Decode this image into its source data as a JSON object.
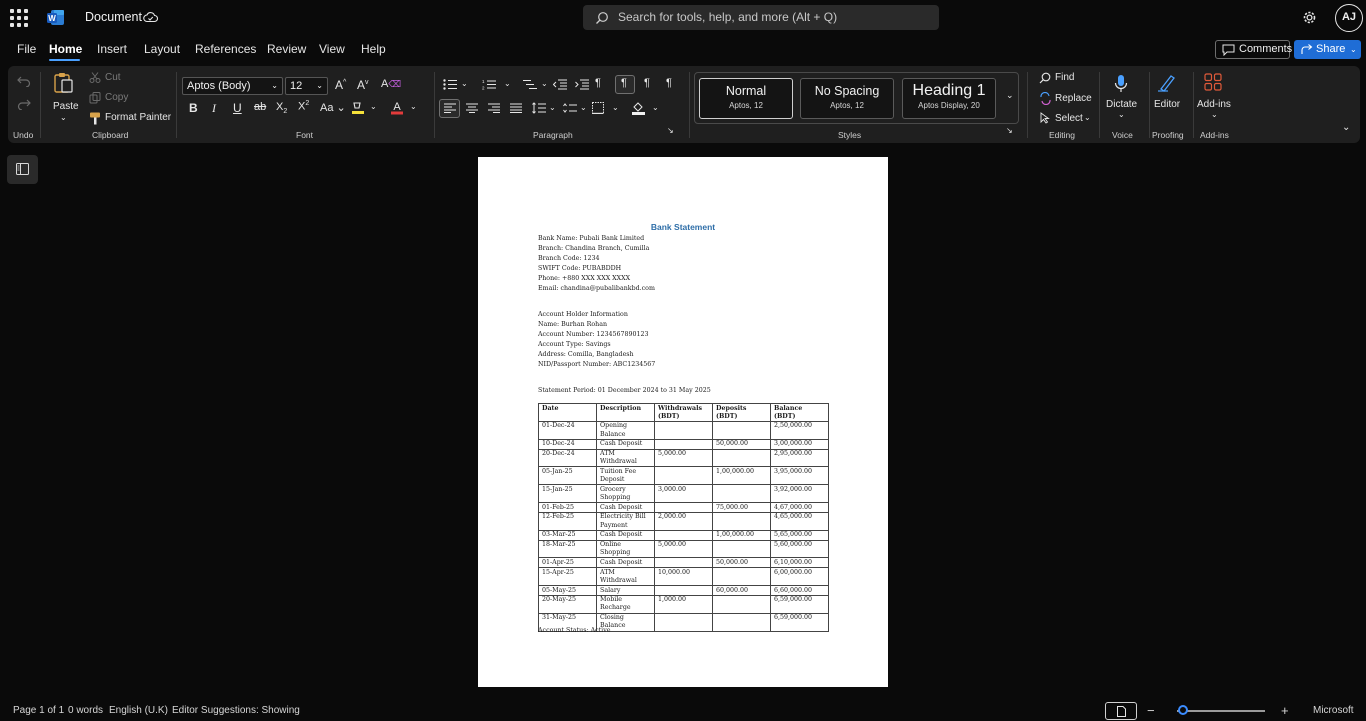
{
  "titlebar": {
    "app_name": "Document",
    "search_placeholder": "Search for tools, help, and more (Alt + Q)",
    "user_initials": "AJ"
  },
  "menu": {
    "tabs": [
      "File",
      "Home",
      "Insert",
      "Layout",
      "References",
      "Review",
      "View",
      "Help"
    ],
    "active_tab": "Home",
    "comments_label": "Comments",
    "share_label": "Share"
  },
  "ribbon": {
    "undo_group": "Undo",
    "clipboard": {
      "paste": "Paste",
      "cut": "Cut",
      "copy": "Copy",
      "format_painter": "Format Painter",
      "group": "Clipboard"
    },
    "font": {
      "family": "Aptos (Body)",
      "size": "12",
      "group": "Font"
    },
    "paragraph": {
      "group": "Paragraph"
    },
    "styles": {
      "group": "Styles",
      "items": [
        {
          "name": "Normal",
          "detail": "Aptos, 12"
        },
        {
          "name": "No Spacing",
          "detail": "Aptos, 12"
        },
        {
          "name": "Heading 1",
          "detail": "Aptos Display, 20"
        }
      ]
    },
    "editing": {
      "find": "Find",
      "replace": "Replace",
      "select": "Select",
      "group": "Editing"
    },
    "voice": {
      "dictate": "Dictate",
      "group": "Voice"
    },
    "proofing": {
      "editor": "Editor",
      "group": "Proofing"
    },
    "addins": {
      "addins": "Add-ins",
      "group": "Add-ins"
    }
  },
  "document": {
    "heading": "Bank Statement",
    "bank_lines": [
      "Bank Name: Pubali Bank Limited",
      "Branch: Chandina Branch, Cumilla",
      "Branch Code: 1234",
      "SWIFT Code: PUBABDDH",
      "Phone: +880 XXX XXX XXXX",
      "Email: chandina@pubalibankbd.com"
    ],
    "holder_lines": [
      "Account Holder Information",
      "Name: Burhan Rohan",
      "Account Number: 1234567890123",
      "Account Type: Savings",
      "Address: Comilla, Bangladesh",
      "NID/Passport Number: ABC1234567"
    ],
    "period": "Statement Period: 01 December 2024 to 31 May 2025",
    "table": {
      "headers": [
        "Date",
        "Description",
        "Withdrawals (BDT)",
        "Deposits (BDT)",
        "Balance (BDT)"
      ],
      "rows": [
        [
          "01-Dec-24",
          "Opening Balance",
          "",
          "",
          "2,50,000.00"
        ],
        [
          "10-Dec-24",
          "Cash Deposit",
          "",
          "50,000.00",
          "3,00,000.00"
        ],
        [
          "20-Dec-24",
          "ATM Withdrawal",
          "5,000.00",
          "",
          "2,95,000.00"
        ],
        [
          "05-Jan-25",
          "Tuition Fee Deposit",
          "",
          "1,00,000.00",
          "3,95,000.00"
        ],
        [
          "15-Jan-25",
          "Grocery Shopping",
          "3,000.00",
          "",
          "3,92,000.00"
        ],
        [
          "01-Feb-25",
          "Cash Deposit",
          "",
          "75,000.00",
          "4,67,000.00"
        ],
        [
          "12-Feb-25",
          "Electricity Bill Payment",
          "2,000.00",
          "",
          "4,65,000.00"
        ],
        [
          "03-Mar-25",
          "Cash Deposit",
          "",
          "1,00,000.00",
          "5,65,000.00"
        ],
        [
          "18-Mar-25",
          "Online Shopping",
          "5,000.00",
          "",
          "5,60,000.00"
        ],
        [
          "01-Apr-25",
          "Cash Deposit",
          "",
          "50,000.00",
          "6,10,000.00"
        ],
        [
          "15-Apr-25",
          "ATM Withdrawal",
          "10,000.00",
          "",
          "6,00,000.00"
        ],
        [
          "05-May-25",
          "Salary",
          "",
          "60,000.00",
          "6,60,000.00"
        ],
        [
          "20-May-25",
          "Mobile Recharge",
          "1,000.00",
          "",
          "6,59,000.00"
        ],
        [
          "31-May-25",
          "Closing Balance",
          "",
          "",
          "6,59,000.00"
        ]
      ]
    },
    "status": "Account Status: Active"
  },
  "statusbar": {
    "page": "Page 1 of 1",
    "words": "0 words",
    "language": "English (U.K)",
    "editor_suggestions": "Editor Suggestions: Showing",
    "zoom_minus": "−",
    "zoom_plus": "+",
    "brand": "Microsoft"
  },
  "colors": {
    "accent": "#1f6dd6",
    "heading": "#2e6ea8",
    "background": "#0a0a0a",
    "ribbon": "#1f1f1f"
  }
}
